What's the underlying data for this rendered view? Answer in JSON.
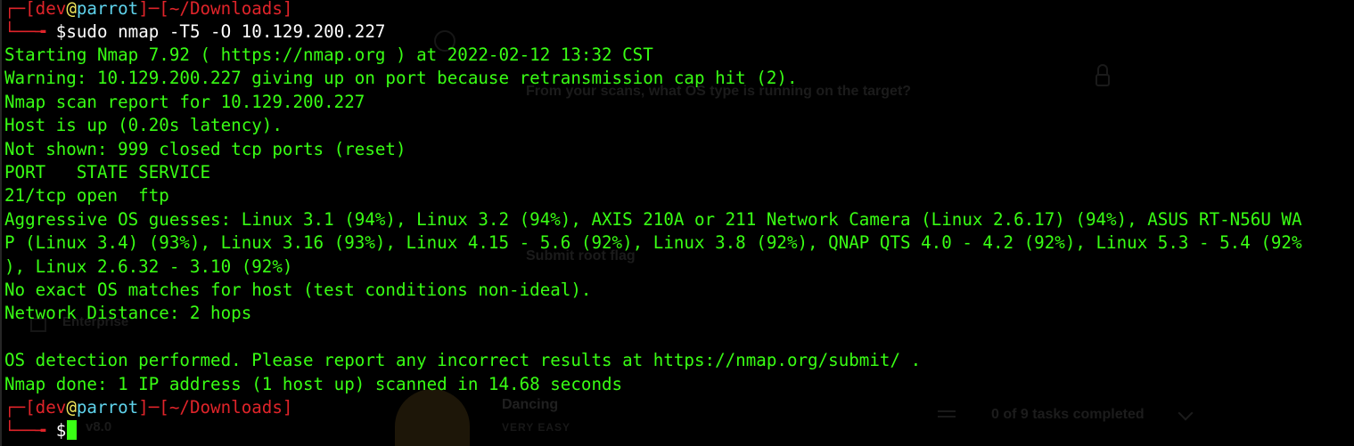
{
  "background_window": {
    "question": "From your scans, what OS type is running on the target?",
    "submit_label": "Submit root flag",
    "enterprise_label": "Enterprise",
    "machine_name": "Dancing",
    "difficulty": "VERY EASY",
    "tasks_status": "0 of 9 tasks completed",
    "version_text": "v8.0"
  },
  "prompt": {
    "open": "┌─[",
    "user": "dev",
    "at": "@",
    "host": "parrot",
    "sep": "]─[",
    "path": "~/Downloads",
    "close": "]",
    "second_prefix": "└──╼ ",
    "dollar": "$"
  },
  "command": "sudo nmap -T5 -O 10.129.200.227",
  "output": [
    "Starting Nmap 7.92 ( https://nmap.org ) at 2022-02-12 13:32 CST",
    "Warning: 10.129.200.227 giving up on port because retransmission cap hit (2).",
    "Nmap scan report for 10.129.200.227",
    "Host is up (0.20s latency).",
    "Not shown: 999 closed tcp ports (reset)",
    "PORT   STATE SERVICE",
    "21/tcp open  ftp",
    "Aggressive OS guesses: Linux 3.1 (94%), Linux 3.2 (94%), AXIS 210A or 211 Network Camera (Linux 2.6.17) (94%), ASUS RT-N56U WA",
    "P (Linux 3.4) (93%), Linux 3.16 (93%), Linux 4.15 - 5.6 (92%), Linux 3.8 (92%), QNAP QTS 4.0 - 4.2 (92%), Linux 5.3 - 5.4 (92%",
    "), Linux 2.6.32 - 3.10 (92%)",
    "No exact OS matches for host (test conditions non-ideal).",
    "Network Distance: 2 hops",
    "",
    "OS detection performed. Please report any incorrect results at https://nmap.org/submit/ .",
    "Nmap done: 1 IP address (1 host up) scanned in 14.68 seconds"
  ],
  "colors": {
    "background": "#000000",
    "output_text": "#39ff14",
    "prompt_frame": "#e0242a",
    "prompt_host": "#5fd3ec",
    "prompt_at": "#f2e85c"
  }
}
